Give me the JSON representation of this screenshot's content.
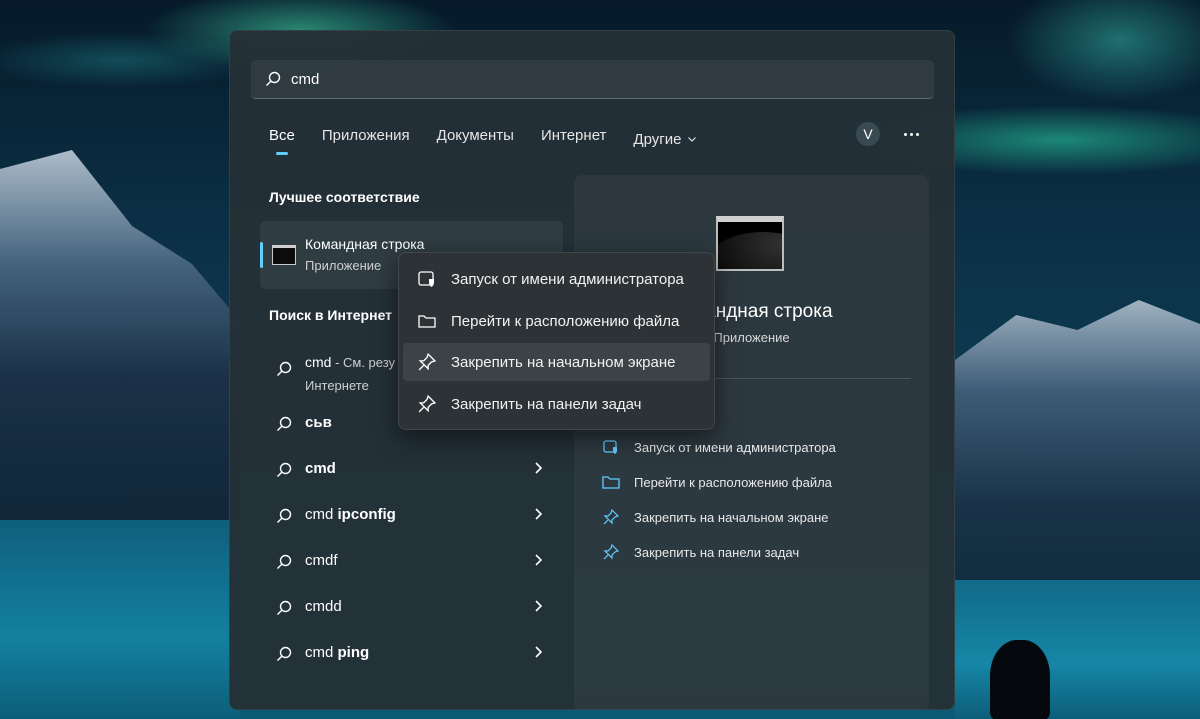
{
  "search": {
    "value": "cmd"
  },
  "tabs": [
    {
      "label": "Все"
    },
    {
      "label": "Приложения"
    },
    {
      "label": "Документы"
    },
    {
      "label": "Интернет"
    },
    {
      "label": "Другие"
    }
  ],
  "account": {
    "initial": "V"
  },
  "best_match": {
    "heading": "Лучшее соответствие",
    "title": "Командная строка",
    "subtitle": "Приложение"
  },
  "web": {
    "heading": "Поиск в Интернет",
    "first": {
      "query": "cmd",
      "suffix": " - См. резу",
      "line2": "Интернете"
    },
    "rows": [
      {
        "prefix": "",
        "bold": "сьв",
        "chevron": false
      },
      {
        "prefix": "",
        "bold": "cmd",
        "chevron": true
      },
      {
        "prefix": "cmd ",
        "bold": "ipconfig",
        "chevron": true
      },
      {
        "prefix": "cmdf",
        "bold": "",
        "chevron": true
      },
      {
        "prefix": "cmdd",
        "bold": "",
        "chevron": true
      },
      {
        "prefix": "cmd ",
        "bold": "ping",
        "chevron": true
      }
    ]
  },
  "detail": {
    "title": "Командная строка",
    "subtitle": "Приложение",
    "actions": [
      {
        "label": "Запуск от имени администратора",
        "icon": "shield-window-icon"
      },
      {
        "label": "Перейти к расположению файла",
        "icon": "folder-icon"
      },
      {
        "label": "Закрепить на начальном экране",
        "icon": "pin-icon"
      },
      {
        "label": "Закрепить на панели задач",
        "icon": "pin-icon"
      }
    ]
  },
  "context_menu": {
    "items": [
      {
        "label": "Запуск от имени администратора",
        "icon": "shield-window-icon"
      },
      {
        "label": "Перейти к расположению файла",
        "icon": "folder-icon"
      },
      {
        "label": "Закрепить на начальном экране",
        "icon": "pin-icon"
      },
      {
        "label": "Закрепить на панели задач",
        "icon": "pin-icon"
      }
    ],
    "highlighted_index": 2
  },
  "colors": {
    "accent": "#60cdff",
    "panel": "#243036",
    "menu": "#2c3236"
  }
}
